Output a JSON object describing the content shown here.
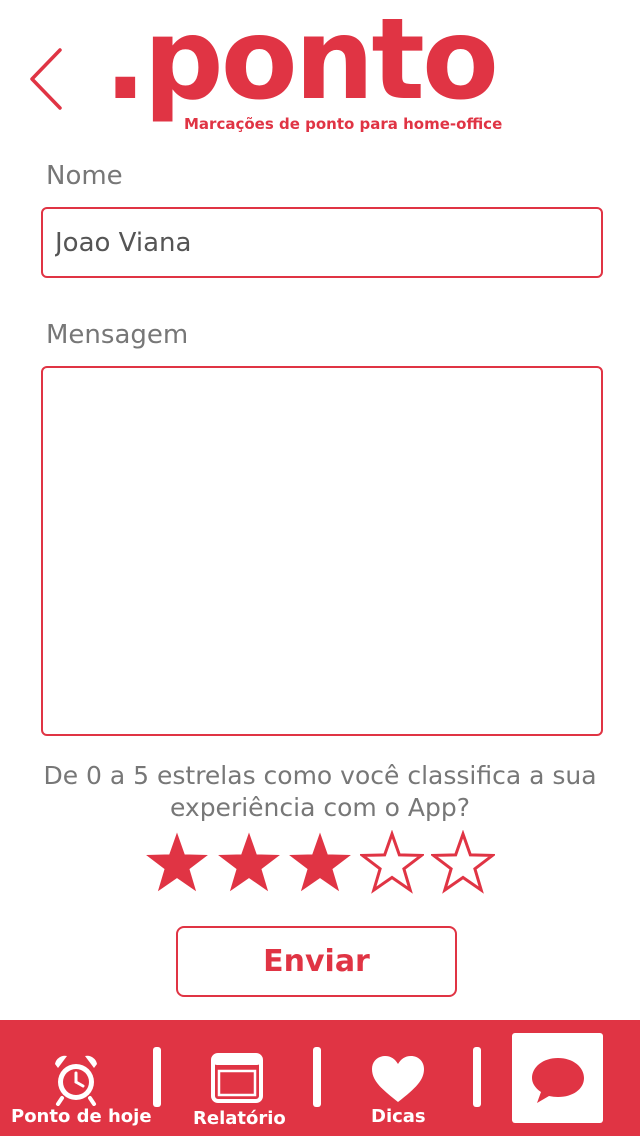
{
  "header": {
    "back_icon": "chevron-left-icon",
    "logo_text": ".ponto",
    "logo_tagline": "Marcações de ponto para home-office"
  },
  "form": {
    "name_label": "Nome",
    "name_value": "Joao Viana",
    "message_label": "Mensagem",
    "message_value": "",
    "rating_question": "De 0 a 5 estrelas como você classifica a sua experiência com o App?",
    "rating_value": 3,
    "rating_max": 5,
    "submit_label": "Enviar"
  },
  "bottom_nav": {
    "items": [
      {
        "label": "Ponto de hoje",
        "icon": "alarm-clock-icon"
      },
      {
        "label": "Relatório",
        "icon": "report-window-icon"
      },
      {
        "label": "Dicas",
        "icon": "heart-icon"
      },
      {
        "label": "",
        "icon": "chat-bubble-icon",
        "active": true
      }
    ]
  },
  "colors": {
    "accent": "#e03444",
    "label_text": "#777777",
    "background": "#ffffff"
  }
}
